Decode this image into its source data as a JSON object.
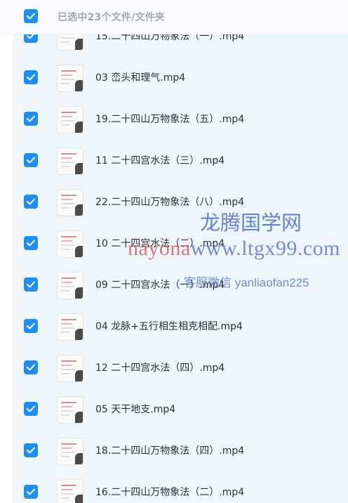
{
  "header": {
    "selection_label": "已选中23个文件/文件夹"
  },
  "files": [
    {
      "name": "15.二十四山万物象法（一）.mp4",
      "checked": true
    },
    {
      "name": "03 峦头和理气.mp4",
      "checked": true
    },
    {
      "name": "19.二十四山万物象法（五）.mp4",
      "checked": true
    },
    {
      "name": "11 二十四宫水法（三）.mp4",
      "checked": true
    },
    {
      "name": "22.二十四山万物象法（八）.mp4",
      "checked": true
    },
    {
      "name": "10 二十四宫水法（二）.mp4",
      "checked": true
    },
    {
      "name": "09 二十四宫水法（一）.mp4",
      "checked": true
    },
    {
      "name": "04 龙脉+五行相生相克相配.mp4",
      "checked": true
    },
    {
      "name": "12 二十四宫水法（四）.mp4",
      "checked": true
    },
    {
      "name": "05 天干地支.mp4",
      "checked": true
    },
    {
      "name": "18.二十四山万物象法（四）.mp4",
      "checked": true
    },
    {
      "name": "16.二十四山万物象法（二）.mp4",
      "checked": true
    }
  ],
  "watermark": {
    "site_name": "龙腾国学网",
    "url_prefix": "nayona",
    "url_main": "www.ltgx99.com",
    "service": "客服微信 yanliaofan225"
  },
  "colors": {
    "accent": "#1e8ff0",
    "list_bg": "#eef6fc"
  },
  "icons": {
    "checkbox": "checkmark-icon",
    "file_thumb": "video-thumbnail-icon"
  }
}
